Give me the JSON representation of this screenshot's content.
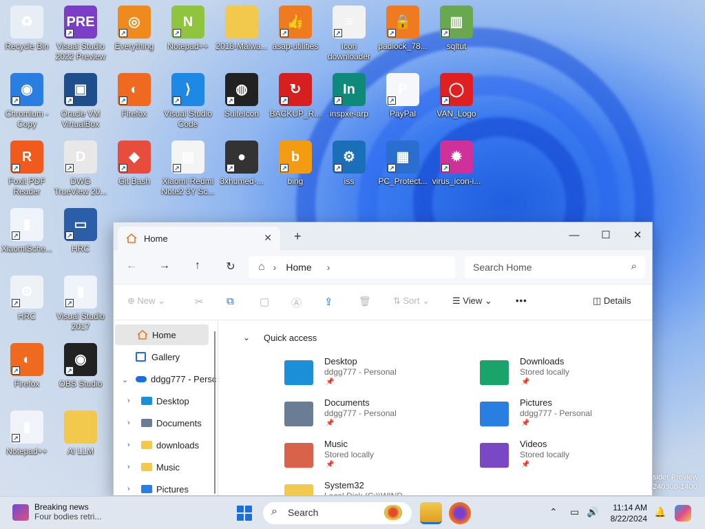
{
  "desktop": {
    "icons": [
      {
        "label": "Recycle Bin",
        "color": "#e8eef6",
        "glyph": "♻"
      },
      {
        "label": "Visual Studio 2022 Preview",
        "color": "#7a3fc4",
        "glyph": "PRE"
      },
      {
        "label": "Everything",
        "color": "#f08a1c",
        "glyph": "◎"
      },
      {
        "label": "Notepad++",
        "color": "#8fc43f",
        "glyph": "N"
      },
      {
        "label": "2018-Malwa...",
        "color": "#f2c94c",
        "glyph": ""
      },
      {
        "label": "asap-utilities",
        "color": "#f07a20",
        "glyph": "👍"
      },
      {
        "label": "Icon downloader",
        "color": "#f2f2f2",
        "glyph": "≡"
      },
      {
        "label": "padlock_78...",
        "color": "#f07a20",
        "glyph": "🔒"
      },
      {
        "label": "sqltut",
        "color": "#6aa84f",
        "glyph": "▥"
      },
      {
        "label": "Chromium - Copy",
        "color": "#2a7de1",
        "glyph": "◉"
      },
      {
        "label": "Oracle VM VirtualBox",
        "color": "#1f4e8c",
        "glyph": "▣"
      },
      {
        "label": "Firefox",
        "color": "#ef6a1f",
        "glyph": "◐"
      },
      {
        "label": "Visual Studio Code",
        "color": "#1e88e5",
        "glyph": "⟩"
      },
      {
        "label": "SuiteIcon",
        "color": "#222222",
        "glyph": "◍"
      },
      {
        "label": "BACKUP_R...",
        "color": "#d62020",
        "glyph": "↻"
      },
      {
        "label": "inspxe-arp",
        "color": "#0f8a7a",
        "glyph": "In"
      },
      {
        "label": "PayPal",
        "color": "#f5f7fa",
        "glyph": "P"
      },
      {
        "label": "VAN_Logo",
        "color": "#e02020",
        "glyph": "◯"
      },
      {
        "label": "Foxit PDF Reader",
        "color": "#f05a1c",
        "glyph": "R"
      },
      {
        "label": "DWG TrueView 20...",
        "color": "#e8e8e8",
        "glyph": "D"
      },
      {
        "label": "Git Bash",
        "color": "#e74c3c",
        "glyph": "◆"
      },
      {
        "label": "Xiaomi Redmi Note2 3Y Sc...",
        "color": "#f4f4f4",
        "glyph": "▤"
      },
      {
        "label": "3xhumed-...",
        "color": "#333333",
        "glyph": "●"
      },
      {
        "label": "bing",
        "color": "#f39c12",
        "glyph": "b"
      },
      {
        "label": "iss",
        "color": "#1a6fb8",
        "glyph": "⚙"
      },
      {
        "label": "PC_Protect...",
        "color": "#2a6fd0",
        "glyph": "▦"
      },
      {
        "label": "virus_icon-i...",
        "color": "#d0309a",
        "glyph": "✹"
      },
      {
        "label": "XiaomiSche...",
        "color": "#f0f4fa",
        "glyph": "▮"
      },
      {
        "label": "HRC",
        "color": "#2b5ea8",
        "glyph": "▭"
      },
      {
        "label": "HRC",
        "color": "#eef2f6",
        "glyph": "⚙"
      },
      {
        "label": "Visual Studio 2017",
        "color": "#f0f4fa",
        "glyph": "▮"
      },
      {
        "label": "Firefox",
        "color": "#ef6a1f",
        "glyph": "◐"
      },
      {
        "label": "OBS Studio",
        "color": "#222222",
        "glyph": "◉"
      },
      {
        "label": "Notepad++",
        "color": "#f0f4fa",
        "glyph": "▮"
      },
      {
        "label": "AI LLM",
        "color": "#f2c94c",
        "glyph": ""
      }
    ]
  },
  "explorer": {
    "tab_label": "Home",
    "tab_close": "✕",
    "new_tab": "+",
    "win_min": "—",
    "win_max": "☐",
    "win_close": "✕",
    "nav": {
      "back": "←",
      "forward": "→",
      "up": "↑",
      "refresh": "↻"
    },
    "address": {
      "home_glyph": "⌂",
      "sep": "›",
      "crumb": "Home",
      "trail": "›"
    },
    "search": {
      "placeholder": "Search Home",
      "icon": "⌕"
    },
    "commands": {
      "new": "⊕  New  ⌄",
      "cut": "✂",
      "copy": "⧉",
      "paste": "▢",
      "rename": "Ⓐ",
      "share": "⇪",
      "delete": "🗑",
      "sort": "⇅  Sort  ⌄",
      "view": "☰  View  ⌄",
      "more": "•••",
      "details": "◫  Details"
    },
    "sidebar": {
      "home": "Home",
      "gallery": "Gallery",
      "onedrive": "ddgg777 - Persc",
      "items": [
        "Desktop",
        "Documents",
        "downloads",
        "Music",
        "Pictures"
      ]
    },
    "quick_access": {
      "header": "Quick access",
      "pin": "📌",
      "tiles": [
        {
          "name": "Desktop",
          "sub": "ddgg777 - Personal",
          "color": "#1b8fd8"
        },
        {
          "name": "Downloads",
          "sub": "Stored locally",
          "color": "#1aa36a"
        },
        {
          "name": "Documents",
          "sub": "ddgg777 - Personal",
          "color": "#6b7d95"
        },
        {
          "name": "Pictures",
          "sub": "ddgg777 - Personal",
          "color": "#2a7de1"
        },
        {
          "name": "Music",
          "sub": "Stored locally",
          "color": "#d9634a"
        },
        {
          "name": "Videos",
          "sub": "Stored locally",
          "color": "#7a48c4"
        },
        {
          "name": "System32",
          "sub": "Local Disk (C:)\\WIND...",
          "color": "#f2c94c"
        }
      ]
    }
  },
  "watermark": {
    "line1": "sider Preview",
    "line2": "240308-1400"
  },
  "taskbar": {
    "news_title": "Breaking news",
    "news_sub": "Four bodies retri...",
    "search_label": "Search",
    "time": "11:14 AM",
    "date": "8/22/2024",
    "tray_chevron": "⌃",
    "tray_net": "▭",
    "tray_vol": "🔊",
    "tray_bell": "🔔"
  },
  "colors": {
    "accent": "#1a6fd8",
    "folder": "#f2c94c"
  }
}
